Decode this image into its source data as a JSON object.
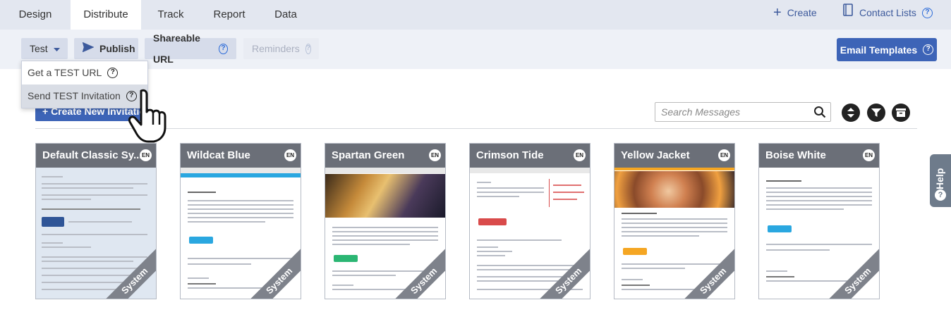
{
  "topnav": {
    "tabs": [
      "Design",
      "Distribute",
      "Track",
      "Report",
      "Data"
    ],
    "create_label": "Create",
    "contact_lists_label": "Contact Lists"
  },
  "toolbar": {
    "test_label": "Test",
    "publish_label": "Publish",
    "shareable_url_label": "Shareable URL",
    "reminders_label": "Reminders",
    "email_templates_label": "Email Templates"
  },
  "test_menu": {
    "items": [
      "Get a TEST URL",
      "Send TEST Invitation"
    ]
  },
  "invitations": {
    "create_label": "+ Create New Invitation",
    "search_placeholder": "Search Messages"
  },
  "templates": [
    {
      "title": "Default Classic Sy...",
      "lang": "EN",
      "badge": "System"
    },
    {
      "title": "Wildcat Blue",
      "lang": "EN",
      "badge": "System"
    },
    {
      "title": "Spartan Green",
      "lang": "EN",
      "badge": "System"
    },
    {
      "title": "Crimson Tide",
      "lang": "EN",
      "badge": "System"
    },
    {
      "title": "Yellow Jacket",
      "lang": "EN",
      "badge": "System"
    },
    {
      "title": "Boise White",
      "lang": "EN",
      "badge": "System"
    }
  ],
  "help_label": "Help",
  "colors": {
    "accent": "#3d64b7",
    "card_header": "#6b6f78",
    "wildcat": "#2aa7e0",
    "spartan": "#2bb673",
    "crimson": "#d94b4b",
    "yellow": "#f5a623",
    "boise": "#2aa7e0"
  }
}
